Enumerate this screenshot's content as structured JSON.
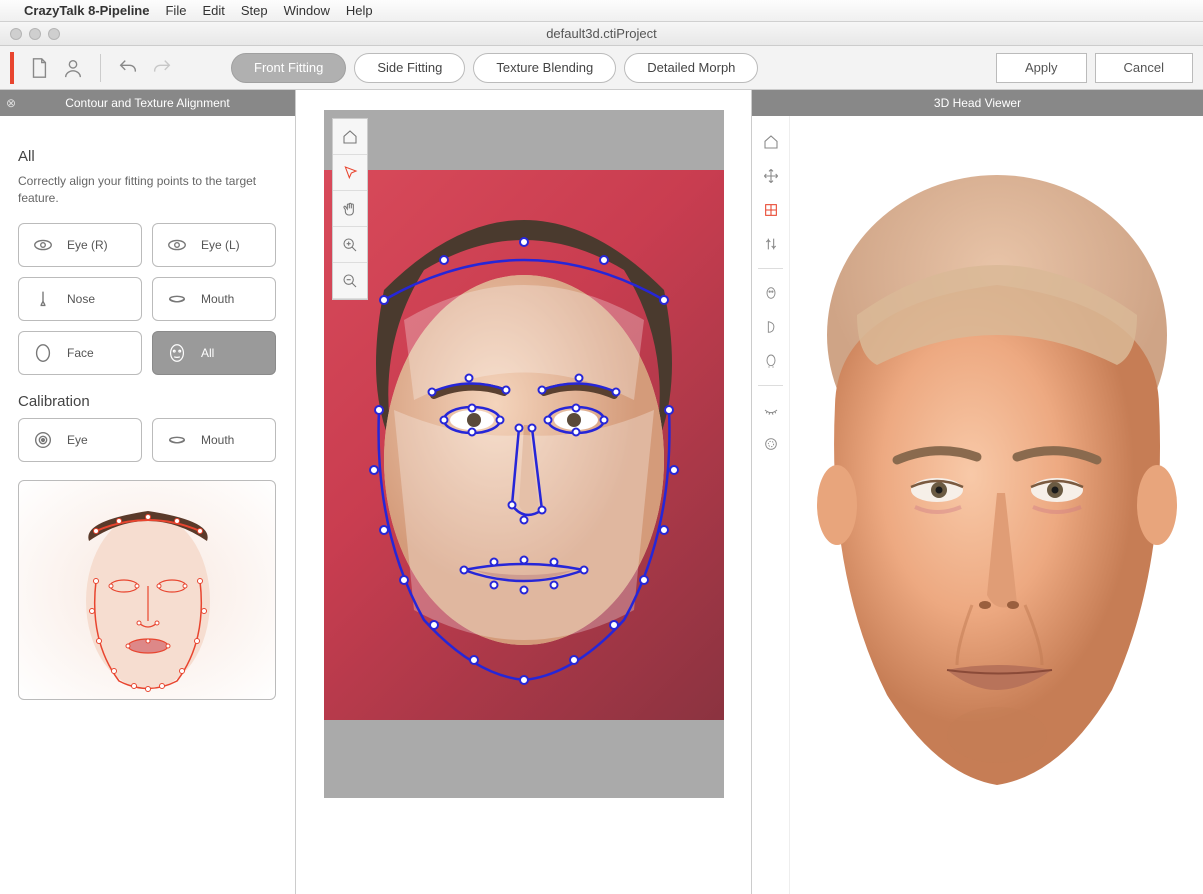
{
  "menubar": {
    "app_name": "CrazyTalk 8-Pipeline",
    "items": [
      "File",
      "Edit",
      "Step",
      "Window",
      "Help"
    ]
  },
  "titlebar": {
    "document": "default3d.ctiProject"
  },
  "toolbar": {
    "tabs": {
      "front_fitting": "Front Fitting",
      "side_fitting": "Side Fitting",
      "texture_blending": "Texture Blending",
      "detailed_morph": "Detailed Morph"
    },
    "apply": "Apply",
    "cancel": "Cancel"
  },
  "left_panel": {
    "title": "Contour and Texture Alignment",
    "section1_title": "All",
    "help_text": "Correctly align your fitting points to the target feature.",
    "feature_buttons": {
      "eye_r": "Eye (R)",
      "eye_l": "Eye (L)",
      "nose": "Nose",
      "mouth": "Mouth",
      "face": "Face",
      "all": "All"
    },
    "calibration_title": "Calibration",
    "calibration_buttons": {
      "eye": "Eye",
      "mouth": "Mouth"
    }
  },
  "right_panel": {
    "title": "3D Head Viewer"
  }
}
